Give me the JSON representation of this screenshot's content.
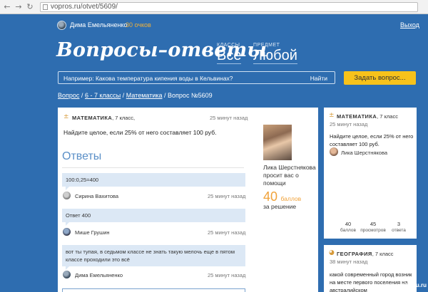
{
  "browser": {
    "url": "vopros.ru/otvet/5609/"
  },
  "topbar": {
    "user_name": "Дима Емельяненко",
    "points": "30 очков",
    "logout": "Выход"
  },
  "header": {
    "title": "Вопросы–ответы",
    "class_label": "КЛАССЫ",
    "class_value": "Все",
    "subject_label": "ПРЕДМЕТ",
    "subject_value": "Любой"
  },
  "search": {
    "placeholder": "Например: Какова температура кипения воды в Кельвинах?",
    "button": "Найти",
    "ask_button": "Задать вопрос..."
  },
  "breadcrumb": {
    "items": [
      "Вопрос",
      "6 - 7 классы",
      "Математика",
      "Вопрос №5609"
    ],
    "separator": "/"
  },
  "question": {
    "subject": "МАТЕМАТИКА",
    "grade": ", 7 класс,",
    "time": "25 минут назад",
    "text": "Найдите целое, если 25% от него составляет 100 руб.",
    "asker_name": "Лика Шерстнякова просит вас о помощи",
    "reward_points": "40",
    "reward_unit": "баллов",
    "reward_note": "за решение"
  },
  "answers": {
    "title": "Ответы",
    "items": [
      {
        "text": "100:0,25=400",
        "author": "Сирина Вахитова",
        "time": "25 минут назад"
      },
      {
        "text": "Ответ 400",
        "author": "Мише Грушин",
        "time": "25 минут назад"
      },
      {
        "text": "вот ты тупая, в седьмом классе не знать такую мелочь еще в пятом классе проходили это всё",
        "author": "Дима Емельяненко",
        "time": "25 минут назад"
      }
    ]
  },
  "sidebar": {
    "card1": {
      "subject": "МАТЕМАТИКА",
      "grade": ", 7 класс",
      "time": "25 минут назад",
      "text": "Найдите целое, если 25% от него составляет 100 руб.",
      "author": "Лика Шерстнякова",
      "stats": [
        {
          "value": "40",
          "label": "баллов"
        },
        {
          "value": "45",
          "label": "просмотров"
        },
        {
          "value": "3",
          "label": "ответа"
        }
      ]
    },
    "card2": {
      "subject": "ГЕОГРАФИЯ",
      "grade": ", 7 класс",
      "time": "38 минут назад",
      "text": "какой современный город возник на месте первого поселения на австралийском"
    }
  },
  "watermark": "pikabu.ru",
  "colors": {
    "background": "#2e6db0",
    "accent_yellow": "#f7c21b",
    "points_orange": "#f0a23a",
    "bubble": "#dce8f5"
  }
}
